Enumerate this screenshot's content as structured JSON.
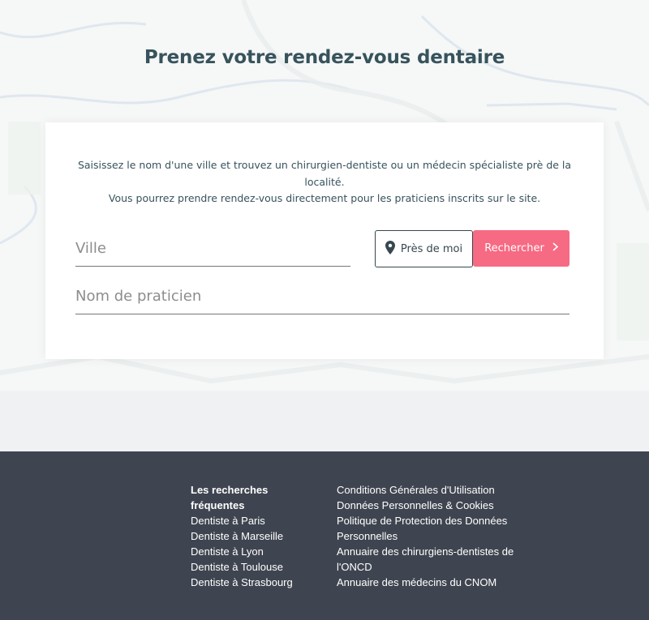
{
  "hero": {
    "title_prefix": "Prenez votre ",
    "title_bold": "rendez-vous dentaire"
  },
  "search_card": {
    "intro_line1": "Saisissez le nom d'une ville et trouvez un chirurgien-dentiste ou un médecin spécialiste prè de la localité.",
    "intro_line2": "Vous pourrez prendre rendez-vous directement pour les praticiens inscrits sur le site.",
    "city_placeholder": "Ville",
    "city_value": "",
    "practitioner_placeholder": "Nom de praticien",
    "practitioner_value": "",
    "near_me_label": "Près de moi",
    "search_label": "Rechercher",
    "accent_color": "#f76a83"
  },
  "footer": {
    "frequent_heading": "Les recherches fréquentes",
    "frequent_links": [
      "Dentiste à Paris",
      "Dentiste à Marseille",
      "Dentiste à Lyon",
      "Dentiste à Toulouse",
      "Dentiste à Strasbourg"
    ],
    "legal_links": [
      "Conditions Générales d'Utilisation",
      "Données Personnelles & Cookies",
      "Politique de Protection des Données Personnelles",
      "Annuaire des chirurgiens-dentistes de l'ONCD",
      "Annuaire des médecins du CNOM"
    ]
  }
}
